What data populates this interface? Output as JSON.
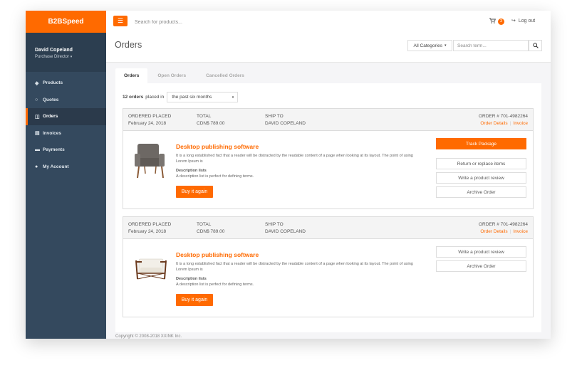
{
  "app": {
    "brand": "B2BSpeed"
  },
  "user": {
    "name": "David Copeland",
    "role": "Purchase Director"
  },
  "sidebar": {
    "items": [
      {
        "label": "Products",
        "icon": "tag-icon"
      },
      {
        "label": "Quotes",
        "icon": "circle-icon"
      },
      {
        "label": "Orders",
        "icon": "document-icon",
        "active": true
      },
      {
        "label": "Invoices",
        "icon": "invoice-icon"
      },
      {
        "label": "Payments",
        "icon": "credit-card-icon"
      },
      {
        "label": "My Account",
        "icon": "user-icon"
      }
    ]
  },
  "topbar": {
    "search_placeholder": "Search for products...",
    "cart_count": "3",
    "logout_label": "Log out"
  },
  "page": {
    "title": "Orders",
    "category_select": "All Categories",
    "term_placeholder": "Search term..."
  },
  "tabs": [
    {
      "label": "Orders",
      "active": true
    },
    {
      "label": "Open Orders"
    },
    {
      "label": "Cancelled Orders"
    }
  ],
  "summary": {
    "count": "12 orders",
    "placed_in": "placed in",
    "period": "the past six months"
  },
  "orders": [
    {
      "placed_label": "ORDERED PLACED",
      "placed_date": "February 24, 2018",
      "total_label": "TOTAL",
      "total_value": "CDN$ 789.00",
      "ship_label": "SHIP TO",
      "ship_value": "DAVID COPELAND",
      "order_number": "ORDER # 701-4982264",
      "details_link": "Order Details",
      "invoice_link": "Invoice",
      "product_title": "Desktop publishing software",
      "product_desc": "It is a long established fact that a reader will be distracted by the readable content of a page when looking at its layout. The point of using Lorem Ipsum is",
      "desc_heading": "Description lists",
      "desc_text": "A description list is perfect for defining terms.",
      "buy_label": "Buy it again",
      "actions": [
        "Track Package",
        "Return or replace items",
        "Write a product review",
        "Archive Order"
      ]
    },
    {
      "placed_label": "ORDERED PLACED",
      "placed_date": "February 24, 2018",
      "total_label": "TOTAL",
      "total_value": "CDN$ 789.00",
      "ship_label": "SHIP TO",
      "ship_value": "DAVID COPELAND",
      "order_number": "ORDER # 701-4982264",
      "details_link": "Order Details",
      "invoice_link": "Invoice",
      "product_title": "Desktop publishing software",
      "product_desc": "It is a long established fact that a reader will be distracted by the readable content of a page when looking at its layout. The point of using Lorem Ipsum is",
      "desc_heading": "Description lists",
      "desc_text": "A description list is perfect for defining terms.",
      "buy_label": "Buy it again",
      "actions": [
        "Write a product review",
        "Archive Order"
      ]
    }
  ],
  "footer": {
    "text": "Copyright © 2008-2018 XXINK Inc."
  },
  "colors": {
    "accent": "#ff6a00",
    "sidebar": "#34495e",
    "sidebar_dark": "#2c3e50"
  }
}
